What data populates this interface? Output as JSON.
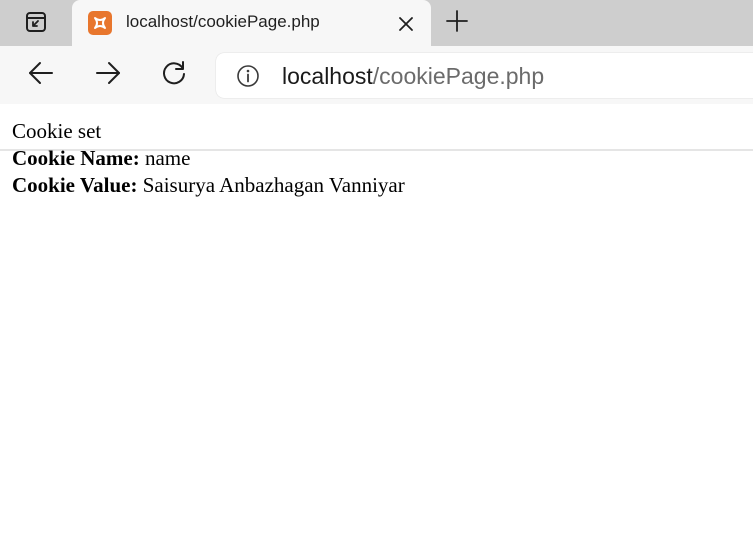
{
  "browser": {
    "tab": {
      "title": "localhost/cookiePage.php"
    },
    "address_bar": {
      "host": "localhost",
      "path": "/cookiePage.php"
    }
  },
  "page": {
    "status_text": "Cookie set",
    "cookie_name_label": "Cookie Name:",
    "cookie_name_value": "name",
    "cookie_value_label": "Cookie Value:",
    "cookie_value_value": "Saisurya Anbazhagan Vanniyar"
  },
  "colors": {
    "tabstrip_bg": "#cecece",
    "toolbar_bg": "#f7f7f7",
    "favicon_accent": "#e8762d"
  },
  "icons": {
    "tab_actions": "tab-actions-icon",
    "favicon": "xampp-favicon-icon",
    "close": "close-icon",
    "new_tab": "plus-icon",
    "back": "arrow-left-icon",
    "forward": "arrow-right-icon",
    "refresh": "refresh-icon",
    "site_info": "info-icon"
  }
}
